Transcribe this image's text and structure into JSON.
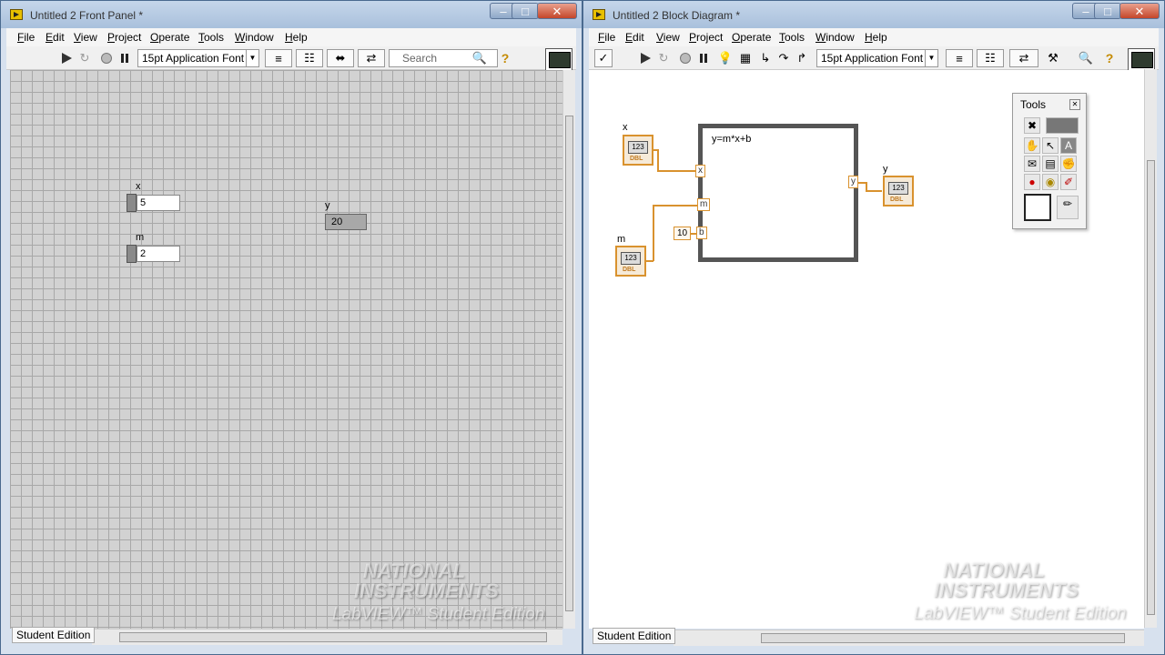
{
  "front_panel": {
    "title": "Untitled 2 Front Panel *",
    "menu": [
      "File",
      "Edit",
      "View",
      "Project",
      "Operate",
      "Tools",
      "Window",
      "Help"
    ],
    "font": "15pt Application Font",
    "search_placeholder": "Search",
    "controls": [
      {
        "label": "x",
        "value": "5"
      },
      {
        "label": "m",
        "value": "2"
      }
    ],
    "indicator": {
      "label": "y",
      "value": "20"
    },
    "status": "Student Edition",
    "watermark": {
      "line1": "NATIONAL",
      "line2": "INSTRUMENTS",
      "line3": "LabVIEW™ Student Edition"
    }
  },
  "block_diagram": {
    "title": "Untitled 2 Block Diagram *",
    "menu": [
      "File",
      "Edit",
      "View",
      "Project",
      "Operate",
      "Tools",
      "Window",
      "Help"
    ],
    "font": "15pt Application Font",
    "formula": "y=m*x+b",
    "ports": {
      "x": "x",
      "m": "m",
      "b": "b",
      "y": "y"
    },
    "terminals": {
      "x": "x",
      "m": "m",
      "y": "y",
      "num": "123",
      "dbl": "DBL"
    },
    "constant": "10",
    "tools_palette": {
      "title": "Tools"
    },
    "status": "Student Edition",
    "watermark": {
      "line1": "NATIONAL",
      "line2": "INSTRUMENTS",
      "line3": "LabVIEW™ Student Edition"
    }
  },
  "window_controls": {
    "minimize": "–",
    "maximize": "□",
    "close": "✕"
  }
}
